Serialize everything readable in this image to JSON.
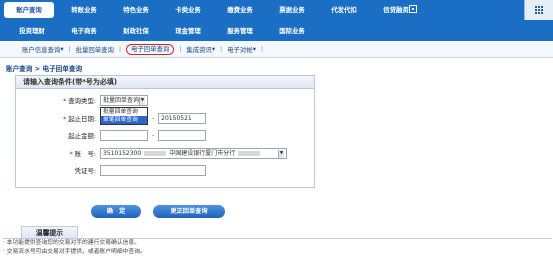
{
  "nav_row1": [
    "账户查询",
    "转账业务",
    "特色业务",
    "卡类业务",
    "缴费业务",
    "票据业务",
    "代发代扣",
    "信贷融资"
  ],
  "nav_row2": [
    "投资理财",
    "电子商务",
    "财政社保",
    "现金管理",
    "服务管理",
    "国际业务"
  ],
  "subnav": [
    "账户信息查询",
    "批量回单查询",
    "电子回单查询",
    "集成资讯",
    "电子对帐"
  ],
  "breadcrumb": "账户查询 > 电子回单查询",
  "form": {
    "header": "请输入查询条件(带*号为必填)",
    "query_type_label": "查询类型:",
    "query_type_value": "批量回单查询",
    "options": [
      "批量回单查询",
      "单笔回单查询"
    ],
    "start_date_label": "起止日期:",
    "end_date": "20150521",
    "amount_label": "起止金额:",
    "account_label": "账　号:",
    "account_no": "3510152300",
    "account_bank": "中国建设银行厦门市分行",
    "voucher_label": "凭证号:"
  },
  "buttons": {
    "confirm": "确　定",
    "switch": "更正回单查询"
  },
  "tips": {
    "title": "温馨提示",
    "lines": [
      "· 本功能提供查询您的交易对手的建行交易确认信息。",
      "· 交易流水号可由交易对手提供，或者账户明细中查询。"
    ]
  }
}
